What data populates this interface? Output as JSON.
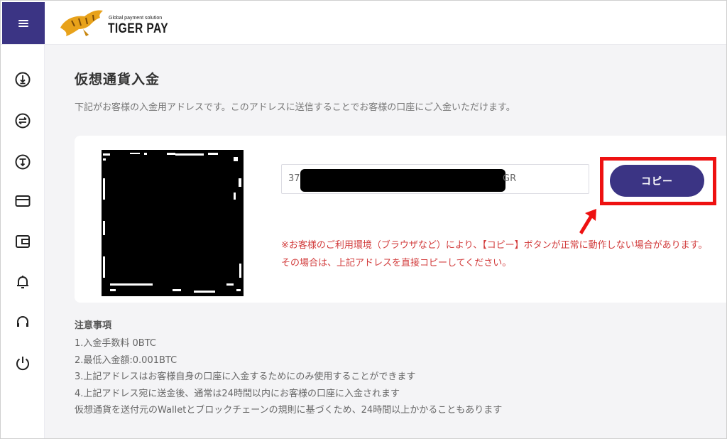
{
  "header": {
    "logo_small": "Global payment solution",
    "logo_big": "TIGER PAY"
  },
  "sidebar": {
    "items": [
      {
        "icon": "circle-down-arrow-icon"
      },
      {
        "icon": "exchange-icon"
      },
      {
        "icon": "circle-t-icon"
      },
      {
        "icon": "card-icon"
      },
      {
        "icon": "wallet-icon"
      },
      {
        "icon": "bell-icon"
      },
      {
        "icon": "headset-icon"
      },
      {
        "icon": "power-icon"
      }
    ]
  },
  "main": {
    "title": "仮想通貨入金",
    "description": "下記がお客様の入金用アドレスです。このアドレスに送信することでお客様の口座にご入金いただけます。",
    "address_start": "37",
    "address_end": "GR",
    "copy_label": "コピー",
    "warning_line1": "※お客様のご利用環境（ブラウザなど）により、【コピー】ボタンが正常に動作しない場合があります。",
    "warning_line2": "その場合は、上記アドレスを直接コピーしてください。"
  },
  "notes": {
    "title": "注意事項",
    "lines": [
      "1.入金手数料 0BTC",
      "2.最低入金額:0.001BTC",
      "3.上記アドレスはお客様自身の口座に入金するためにのみ使用することができます",
      "4.上記アドレス宛に送金後、通常は24時間以内にお客様の口座に入金されます",
      "仮想通貨を送付元のWalletとブロックチェーンの規則に基づくため、24時間以上かかることもあります"
    ]
  },
  "colors": {
    "accent": "#3b3484",
    "warning": "#d23c3c",
    "highlight": "#ee1111"
  }
}
